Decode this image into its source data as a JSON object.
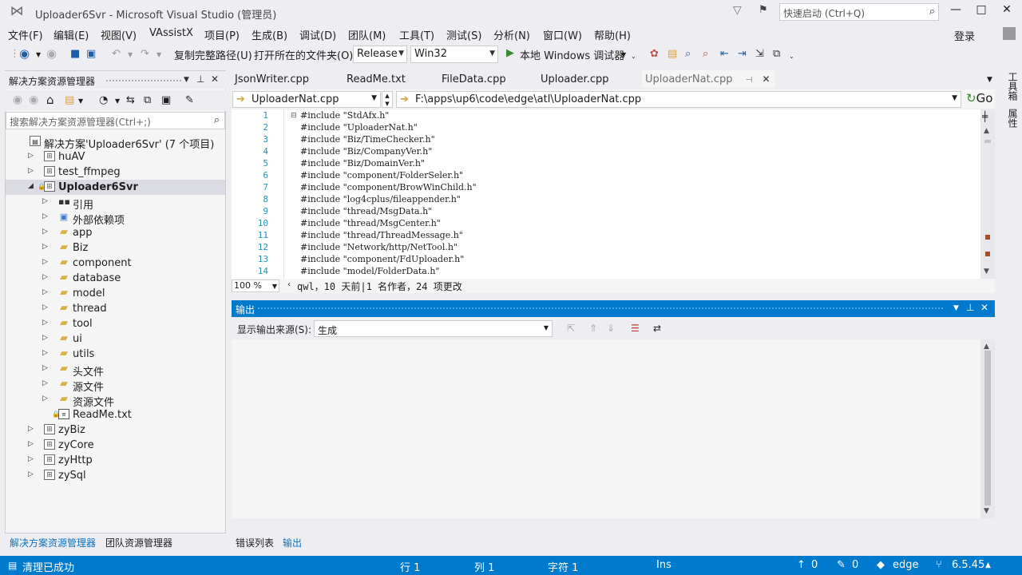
{
  "window": {
    "title": "Uploader6Svr - Microsoft Visual Studio (管理员)",
    "quick_launch_placeholder": "快速启动 (Ctrl+Q)",
    "minimize": "—",
    "maximize": "□",
    "close": "✕"
  },
  "menu": {
    "items": [
      "文件(F)",
      "编辑(E)",
      "视图(V)",
      "VAssistX",
      "项目(P)",
      "生成(B)",
      "调试(D)",
      "团队(M)",
      "工具(T)",
      "测试(S)",
      "分析(N)",
      "窗口(W)",
      "帮助(H)"
    ],
    "login": "登录"
  },
  "toolbar": {
    "copy_path": "复制完整路径(U)",
    "open_folder": "打开所在的文件夹(O)",
    "config": "Release",
    "platform": "Win32",
    "debugger": "本地 Windows 调试器",
    "run_glyph": "▶"
  },
  "right_strip": {
    "toolbox": "工具箱",
    "properties": "属性"
  },
  "solution_explorer": {
    "title": "解决方案资源管理器",
    "search_placeholder": "搜索解决方案资源管理器(Ctrl+;)",
    "tree": [
      {
        "label": "解决方案'Uploader6Svr' (7 个项目)",
        "icon": "solution-icon",
        "indent": 0,
        "expander": ""
      },
      {
        "label": "huAV",
        "icon": "project-icon",
        "indent": 1,
        "expander": "▷"
      },
      {
        "label": "test_ffmpeg",
        "icon": "project-icon",
        "indent": 1,
        "expander": "▷"
      },
      {
        "label": "Uploader6Svr",
        "icon": "project-icon",
        "indent": 1,
        "expander": "◢",
        "bold": true
      },
      {
        "label": "引用",
        "icon": "references-icon",
        "indent": 2,
        "expander": "▷"
      },
      {
        "label": "外部依赖项",
        "icon": "external-deps-icon",
        "indent": 2,
        "expander": "▷"
      },
      {
        "label": "app",
        "icon": "folder-icon",
        "indent": 2,
        "expander": "▷"
      },
      {
        "label": "Biz",
        "icon": "folder-icon",
        "indent": 2,
        "expander": "▷"
      },
      {
        "label": "component",
        "icon": "folder-icon",
        "indent": 2,
        "expander": "▷"
      },
      {
        "label": "database",
        "icon": "folder-icon",
        "indent": 2,
        "expander": "▷"
      },
      {
        "label": "model",
        "icon": "folder-icon",
        "indent": 2,
        "expander": "▷"
      },
      {
        "label": "thread",
        "icon": "folder-icon",
        "indent": 2,
        "expander": "▷"
      },
      {
        "label": "tool",
        "icon": "folder-icon",
        "indent": 2,
        "expander": "▷"
      },
      {
        "label": "ui",
        "icon": "folder-icon",
        "indent": 2,
        "expander": "▷"
      },
      {
        "label": "utils",
        "icon": "folder-icon",
        "indent": 2,
        "expander": "▷"
      },
      {
        "label": "头文件",
        "icon": "folder-icon",
        "indent": 2,
        "expander": "▷"
      },
      {
        "label": "源文件",
        "icon": "folder-icon",
        "indent": 2,
        "expander": "▷"
      },
      {
        "label": "资源文件",
        "icon": "folder-icon",
        "indent": 2,
        "expander": "▷"
      },
      {
        "label": "ReadMe.txt",
        "icon": "text-file-icon",
        "indent": 2,
        "expander": ""
      },
      {
        "label": "zyBiz",
        "icon": "project-icon",
        "indent": 1,
        "expander": "▷"
      },
      {
        "label": "zyCore",
        "icon": "project-icon",
        "indent": 1,
        "expander": "▷"
      },
      {
        "label": "zyHttp",
        "icon": "project-icon",
        "indent": 1,
        "expander": "▷"
      },
      {
        "label": "zySql",
        "icon": "project-icon",
        "indent": 1,
        "expander": "▷"
      }
    ],
    "bottom_tabs": [
      "解决方案资源管理器",
      "团队资源管理器"
    ]
  },
  "editor": {
    "tabs": [
      "JsonWriter.cpp",
      "ReadMe.txt",
      "FileData.cpp",
      "Uploader.cpp",
      "UploaderNat.cpp"
    ],
    "active_tab": "UploaderNat.cpp",
    "file_combo": "UploaderNat.cpp",
    "path_combo": "F:\\apps\\up6\\code\\edge\\atl\\UploaderNat.cpp",
    "go_label": "Go",
    "line_numbers": [
      "1",
      "2",
      "3",
      "4",
      "5",
      "6",
      "7",
      "8",
      "9",
      "10",
      "11",
      "12",
      "13",
      "14"
    ],
    "lines": [
      "#include \"StdAfx.h\"",
      "#include \"UploaderNat.h\"",
      "#include \"Biz/TimeChecker.h\"",
      "#include \"Biz/CompanyVer.h\"",
      "#include \"Biz/DomainVer.h\"",
      "#include \"component/FolderSeler.h\"",
      "#include \"component/BrowWinChild.h\"",
      "#include \"log4cplus/fileappender.h\"",
      "#include \"thread/MsgData.h\"",
      "#include \"thread/MsgCenter.h\"",
      "#include \"thread/ThreadMessage.h\"",
      "#include \"Network/http/NetTool.h\"",
      "#include \"component/FdUploader.h\"",
      "#include \"model/FolderData.h\""
    ],
    "zoom": "100 %",
    "codelens": "qwl，10 天前|1 名作者，24 项更改"
  },
  "output": {
    "title": "输出",
    "source_label": "显示输出来源(S):",
    "source_value": "生成",
    "bottom_tabs": [
      "错误列表",
      "输出"
    ]
  },
  "statusbar": {
    "message": "清理已成功",
    "line": "行 1",
    "col": "列 1",
    "char": "字符 1",
    "mode": "Ins",
    "up_count": "0",
    "pencil_count": "0",
    "branch": "edge",
    "version": "6.5.45"
  },
  "colors": {
    "accent": "#007acc",
    "selection": "#cce8ff",
    "line_number": "#2b91af"
  }
}
